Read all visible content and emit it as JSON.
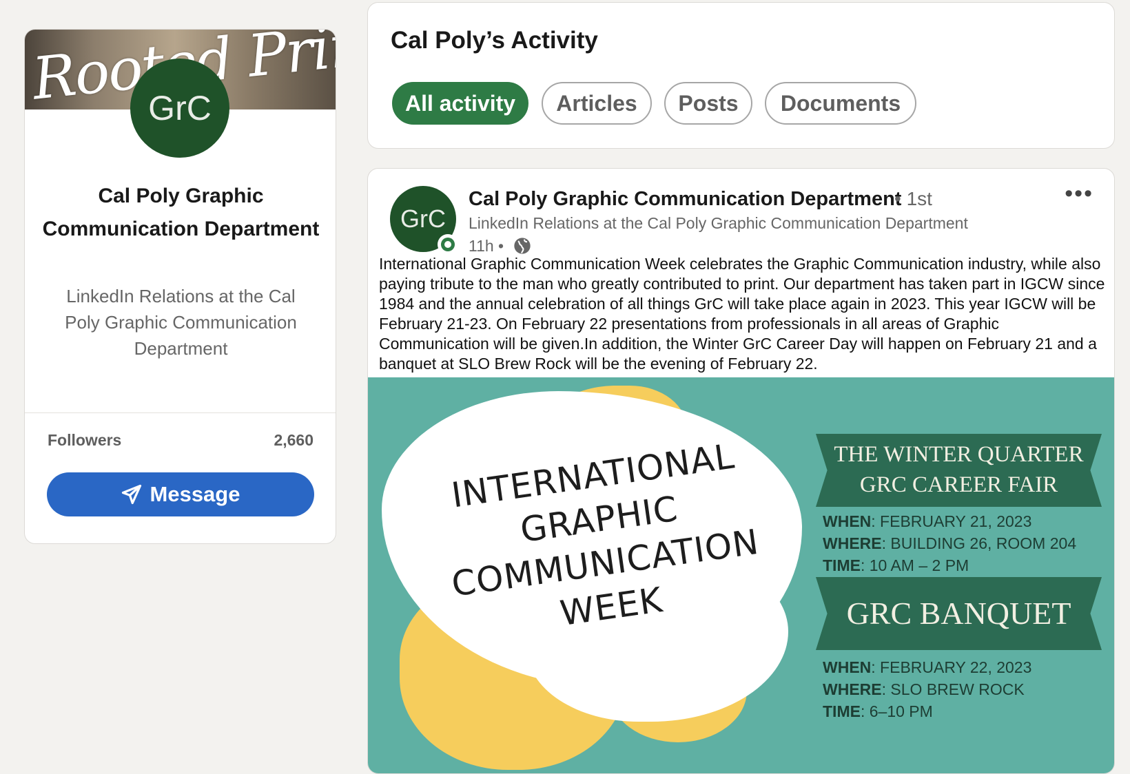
{
  "profile": {
    "banner_text": "Rooted Print",
    "logo_text": "GrC",
    "name": "Cal Poly Graphic Communication Department",
    "headline": "LinkedIn Relations at the Cal Poly Graphic Communication Department",
    "followers_label": "Followers",
    "followers_count": "2,660",
    "message_label": "Message"
  },
  "activity": {
    "title": "Cal Poly’s Activity",
    "filters": [
      {
        "label": "All activity",
        "active": true
      },
      {
        "label": "Articles",
        "active": false
      },
      {
        "label": "Posts",
        "active": false
      },
      {
        "label": "Documents",
        "active": false
      }
    ]
  },
  "post": {
    "logo_text": "GrC",
    "author": "Cal Poly Graphic Communication Department",
    "degree": "• 1st",
    "subtitle": "LinkedIn Relations at the Cal Poly Graphic Communication Department",
    "time": "11h •",
    "more_icon": "•••",
    "text": "International Graphic Communication Week celebrates the Graphic Communication industry, while also paying tribute to the man who greatly contributed to print. Our department has taken part in IGCW since 1984 and the annual celebration of all things GrC will take place again in 2023. This year IGCW will be February 21-23.  On February 22 presentations from professionals in all areas of Graphic Communication will be given.In addition, the Winter GrC Career Day will happen on February 21 and a banquet at SLO Brew Rock will be the evening of February 22.",
    "image": {
      "title_lines": [
        "INTERNATIONAL",
        "GRAPHIC",
        "COMMUNICATION",
        "WEEK"
      ],
      "event1": {
        "ribbon_lines": [
          "THE WINTER QUARTER",
          "GRC CAREER FAIR"
        ],
        "when_label": "WHEN",
        "when": ": FEBRUARY 21, 2023",
        "where_label": "WHERE",
        "where": ": BUILDING 26, ROOM 204",
        "time_label": "TIME",
        "time": ": 10 AM – 2 PM"
      },
      "event2": {
        "ribbon": "GRC BANQUET",
        "when_label": "WHEN",
        "when": ": FEBRUARY 22, 2023",
        "where_label": "WHERE",
        "where": ": SLO BREW ROCK",
        "time_label": "TIME",
        "time": ": 6–10 PM"
      }
    }
  },
  "colors": {
    "brand_green": "#1f5229",
    "accent_green": "#2e7b45",
    "message_blue": "#2a67c5",
    "image_teal": "#5fb0a3",
    "image_yellow": "#f6cd5c",
    "ribbon_green": "#2c6b53"
  }
}
